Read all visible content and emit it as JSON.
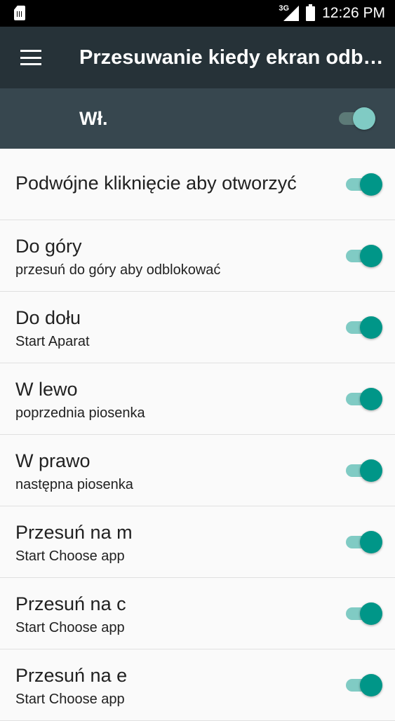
{
  "status_bar": {
    "network": "3G",
    "time": "12:26 PM"
  },
  "app_bar": {
    "title": "Przesuwanie kiedy ekran odblokowany"
  },
  "master_switch": {
    "label": "Wł.",
    "state": "on"
  },
  "settings": [
    {
      "title": "Podwójne kliknięcie aby otworzyć",
      "subtitle": "",
      "state": "on"
    },
    {
      "title": "Do góry",
      "subtitle": "przesuń do góry aby odblokować",
      "state": "on"
    },
    {
      "title": "Do dołu",
      "subtitle": "Start Aparat",
      "state": "on"
    },
    {
      "title": "W lewo",
      "subtitle": "poprzednia piosenka",
      "state": "on"
    },
    {
      "title": "W prawo",
      "subtitle": "następna piosenka",
      "state": "on"
    },
    {
      "title": "Przesuń na m",
      "subtitle": "Start Choose app",
      "state": "on"
    },
    {
      "title": "Przesuń na c",
      "subtitle": "Start Choose app",
      "state": "on"
    },
    {
      "title": "Przesuń na e",
      "subtitle": "Start Choose app",
      "state": "on"
    }
  ],
  "colors": {
    "status_bar": "#000000",
    "app_bar": "#263238",
    "master_bar": "#37474f",
    "accent": "#009688",
    "accent_track": "#80cbc4",
    "background": "#fafafa"
  },
  "icons": {
    "status_left": "sim-card-icon",
    "signal": "signal-icon",
    "battery": "battery-icon",
    "menu": "hamburger-menu-icon"
  }
}
